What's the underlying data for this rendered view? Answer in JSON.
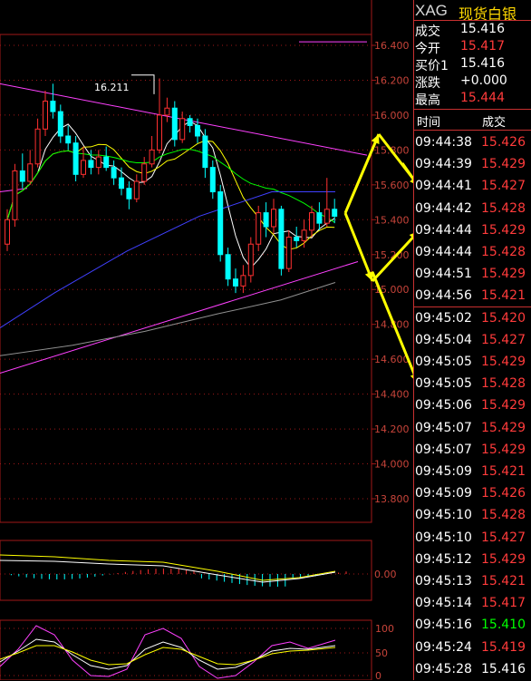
{
  "chart_data": {
    "type": "candlestick",
    "main_axis": {
      "ticks": [
        "16.400",
        "16.200",
        "16.000",
        "15.800",
        "15.600",
        "15.400",
        "15.200",
        "15.000",
        "14.800",
        "14.600",
        "14.400",
        "14.200",
        "14.000",
        "13.800"
      ],
      "ymin": 13.8,
      "ymax": 16.4
    },
    "annotation": "16.211",
    "candles": [
      {
        "o": 15.26,
        "c": 15.4,
        "h": 15.46,
        "l": 15.22
      },
      {
        "o": 15.4,
        "c": 15.68,
        "h": 15.72,
        "l": 15.36
      },
      {
        "o": 15.68,
        "c": 15.62,
        "h": 15.78,
        "l": 15.58
      },
      {
        "o": 15.62,
        "c": 15.72,
        "h": 15.8,
        "l": 15.6
      },
      {
        "o": 15.72,
        "c": 15.92,
        "h": 15.98,
        "l": 15.7
      },
      {
        "o": 15.92,
        "c": 16.08,
        "h": 16.14,
        "l": 15.88
      },
      {
        "o": 16.08,
        "c": 16.02,
        "h": 16.18,
        "l": 15.98
      },
      {
        "o": 16.02,
        "c": 15.88,
        "h": 16.06,
        "l": 15.84
      },
      {
        "o": 15.88,
        "c": 15.84,
        "h": 15.94,
        "l": 15.8
      },
      {
        "o": 15.84,
        "c": 15.66,
        "h": 15.88,
        "l": 15.62
      },
      {
        "o": 15.66,
        "c": 15.74,
        "h": 15.82,
        "l": 15.64
      },
      {
        "o": 15.74,
        "c": 15.7,
        "h": 15.8,
        "l": 15.66
      },
      {
        "o": 15.7,
        "c": 15.76,
        "h": 15.8,
        "l": 15.66
      },
      {
        "o": 15.76,
        "c": 15.7,
        "h": 15.82,
        "l": 15.68
      },
      {
        "o": 15.7,
        "c": 15.64,
        "h": 15.74,
        "l": 15.6
      },
      {
        "o": 15.64,
        "c": 15.58,
        "h": 15.7,
        "l": 15.54
      },
      {
        "o": 15.58,
        "c": 15.52,
        "h": 15.62,
        "l": 15.46
      },
      {
        "o": 15.52,
        "c": 15.62,
        "h": 15.66,
        "l": 15.5
      },
      {
        "o": 15.62,
        "c": 15.72,
        "h": 15.76,
        "l": 15.6
      },
      {
        "o": 15.72,
        "c": 15.8,
        "h": 15.88,
        "l": 15.7
      },
      {
        "o": 15.8,
        "c": 16.0,
        "h": 16.21,
        "l": 15.78
      },
      {
        "o": 16.0,
        "c": 16.04,
        "h": 16.1,
        "l": 15.96
      },
      {
        "o": 16.04,
        "c": 15.86,
        "h": 16.08,
        "l": 15.82
      },
      {
        "o": 15.86,
        "c": 15.98,
        "h": 16.02,
        "l": 15.84
      },
      {
        "o": 15.98,
        "c": 15.94,
        "h": 16.0,
        "l": 15.9
      },
      {
        "o": 15.94,
        "c": 15.88,
        "h": 15.98,
        "l": 15.84
      },
      {
        "o": 15.88,
        "c": 15.7,
        "h": 15.92,
        "l": 15.64
      },
      {
        "o": 15.7,
        "c": 15.56,
        "h": 15.74,
        "l": 15.52
      },
      {
        "o": 15.56,
        "c": 15.2,
        "h": 15.6,
        "l": 15.16
      },
      {
        "o": 15.2,
        "c": 15.06,
        "h": 15.24,
        "l": 15.02
      },
      {
        "o": 15.06,
        "c": 15.02,
        "h": 15.12,
        "l": 14.98
      },
      {
        "o": 15.02,
        "c": 15.08,
        "h": 15.14,
        "l": 14.98
      },
      {
        "o": 15.08,
        "c": 15.26,
        "h": 15.3,
        "l": 15.04
      },
      {
        "o": 15.26,
        "c": 15.44,
        "h": 15.48,
        "l": 15.22
      },
      {
        "o": 15.44,
        "c": 15.36,
        "h": 15.5,
        "l": 15.3
      },
      {
        "o": 15.36,
        "c": 15.46,
        "h": 15.52,
        "l": 15.32
      },
      {
        "o": 15.46,
        "c": 15.12,
        "h": 15.48,
        "l": 15.08
      },
      {
        "o": 15.12,
        "c": 15.3,
        "h": 15.34,
        "l": 15.1
      },
      {
        "o": 15.3,
        "c": 15.28,
        "h": 15.36,
        "l": 15.24
      },
      {
        "o": 15.28,
        "c": 15.34,
        "h": 15.4,
        "l": 15.24
      },
      {
        "o": 15.34,
        "c": 15.44,
        "h": 15.48,
        "l": 15.3
      },
      {
        "o": 15.44,
        "c": 15.38,
        "h": 15.5,
        "l": 15.34
      },
      {
        "o": 15.38,
        "c": 15.46,
        "h": 15.64,
        "l": 15.36
      },
      {
        "o": 15.46,
        "c": 15.42,
        "h": 15.52,
        "l": 15.38
      }
    ],
    "macd_axis": {
      "ticks": [
        "0.00"
      ]
    },
    "kdj_axis": {
      "ticks": [
        "100",
        "50",
        "0"
      ]
    },
    "colors": {
      "up": "#ff3030",
      "down": "#00ffff",
      "ma5": "#ffffff",
      "ma10": "#ffff00",
      "ma20": "#00ff00",
      "ma60": "#4040ff",
      "ma120": "#909090",
      "trendline": "#ff40ff",
      "arrow": "#ffff00",
      "grid": "#a01818"
    }
  },
  "panel": {
    "symbol": "XAG",
    "name": "现货白银",
    "quote": [
      {
        "label": "成交",
        "value": "15.416",
        "color": "#ffffff"
      },
      {
        "label": "今开",
        "value": "15.417",
        "color": "#ff3b3b"
      },
      {
        "label": "买价1",
        "value": "15.416",
        "color": "#ffffff"
      },
      {
        "label": "涨跌",
        "value": "+0.000",
        "color": "#ffffff"
      },
      {
        "label": "最高",
        "value": "15.444",
        "color": "#ff3b3b"
      }
    ],
    "trade_header": {
      "time": "时间",
      "price": "成交"
    },
    "trades": [
      {
        "time": "09:44:38",
        "price": "15.426",
        "color": "#ff3b3b"
      },
      {
        "time": "09:44:39",
        "price": "15.429",
        "color": "#ff3b3b"
      },
      {
        "time": "09:44:41",
        "price": "15.427",
        "color": "#ff3b3b"
      },
      {
        "time": "09:44:42",
        "price": "15.428",
        "color": "#ff3b3b"
      },
      {
        "time": "09:44:44",
        "price": "15.429",
        "color": "#ff3b3b"
      },
      {
        "time": "09:44:44",
        "price": "15.428",
        "color": "#ff3b3b"
      },
      {
        "time": "09:44:51",
        "price": "15.429",
        "color": "#ff3b3b"
      },
      {
        "time": "09:44:56",
        "price": "15.421",
        "color": "#ff3b3b"
      },
      {
        "time": "09:45:02",
        "price": "15.420",
        "color": "#ff3b3b"
      },
      {
        "time": "09:45:04",
        "price": "15.427",
        "color": "#ff3b3b"
      },
      {
        "time": "09:45:05",
        "price": "15.429",
        "color": "#ff3b3b"
      },
      {
        "time": "09:45:05",
        "price": "15.428",
        "color": "#ff3b3b"
      },
      {
        "time": "09:45:06",
        "price": "15.429",
        "color": "#ff3b3b"
      },
      {
        "time": "09:45:07",
        "price": "15.429",
        "color": "#ff3b3b"
      },
      {
        "time": "09:45:07",
        "price": "15.429",
        "color": "#ff3b3b"
      },
      {
        "time": "09:45:09",
        "price": "15.421",
        "color": "#ff3b3b"
      },
      {
        "time": "09:45:09",
        "price": "15.426",
        "color": "#ff3b3b"
      },
      {
        "time": "09:45:10",
        "price": "15.428",
        "color": "#ff3b3b"
      },
      {
        "time": "09:45:10",
        "price": "15.427",
        "color": "#ff3b3b"
      },
      {
        "time": "09:45:12",
        "price": "15.429",
        "color": "#ff3b3b"
      },
      {
        "time": "09:45:13",
        "price": "15.421",
        "color": "#ff3b3b"
      },
      {
        "time": "09:45:14",
        "price": "15.417",
        "color": "#ff3b3b"
      },
      {
        "time": "09:45:16",
        "price": "15.410",
        "color": "#00ff00"
      },
      {
        "time": "09:45:24",
        "price": "15.419",
        "color": "#ff3b3b"
      },
      {
        "time": "09:45:28",
        "price": "15.416",
        "color": "#ffffff"
      }
    ]
  }
}
